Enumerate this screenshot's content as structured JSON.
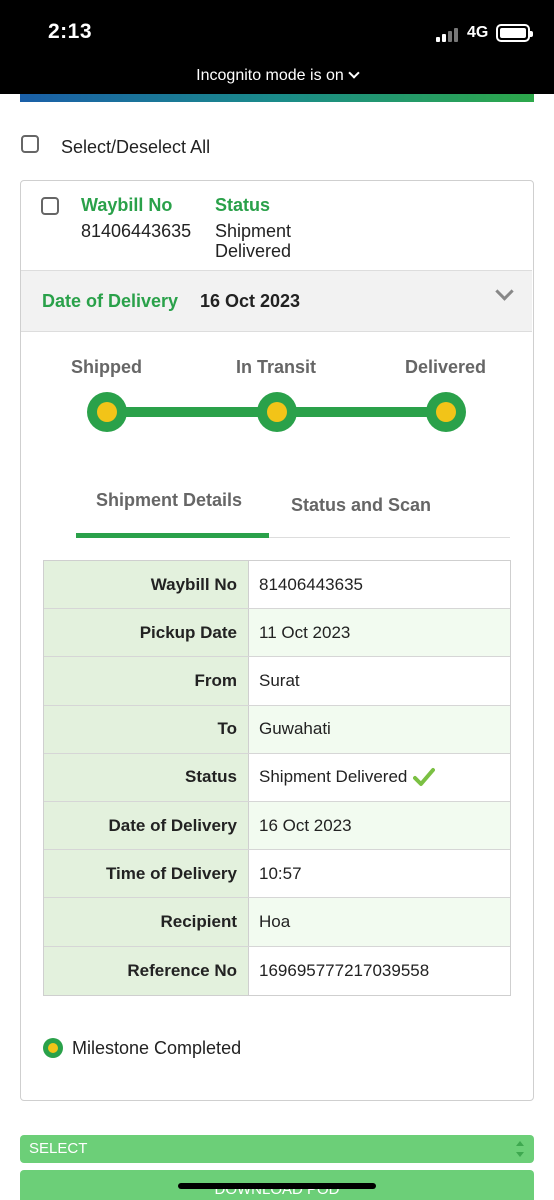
{
  "statusbar": {
    "time": "2:13",
    "network": "4G",
    "incognito": "Incognito mode is on"
  },
  "select_all": {
    "label": "Select/Deselect All"
  },
  "card": {
    "waybill_label": "Waybill No",
    "waybill_value": "81406443635",
    "status_label": "Status",
    "status_value": "Shipment Delivered",
    "dod_label": "Date of Delivery",
    "dod_value": "16 Oct 2023"
  },
  "progress": {
    "steps": [
      "Shipped",
      "In Transit",
      "Delivered"
    ],
    "completed_steps": 3
  },
  "tabs": [
    {
      "label": "Shipment Details",
      "active": true
    },
    {
      "label": "Status and Scan",
      "active": false
    }
  ],
  "details": [
    {
      "key": "Waybill No",
      "value": "81406443635"
    },
    {
      "key": "Pickup Date",
      "value": "11 Oct 2023"
    },
    {
      "key": "From",
      "value": "Surat"
    },
    {
      "key": "To",
      "value": "Guwahati"
    },
    {
      "key": "Status",
      "value": "Shipment Delivered",
      "icon": "check-icon"
    },
    {
      "key": "Date of Delivery",
      "value": "16 Oct 2023"
    },
    {
      "key": "Time of Delivery",
      "value": "10:57"
    },
    {
      "key": "Recipient",
      "value": "Hoa"
    },
    {
      "key": "Reference No",
      "value": "169695777217039558"
    }
  ],
  "legend": {
    "label": "Milestone Completed"
  },
  "bottom": {
    "select_label": "SELECT",
    "download_label": "DOWNLOAD POD"
  },
  "colors": {
    "accent_green": "#2aa14a",
    "milestone_yellow": "#f2c418",
    "button_green": "#6ccf78"
  }
}
